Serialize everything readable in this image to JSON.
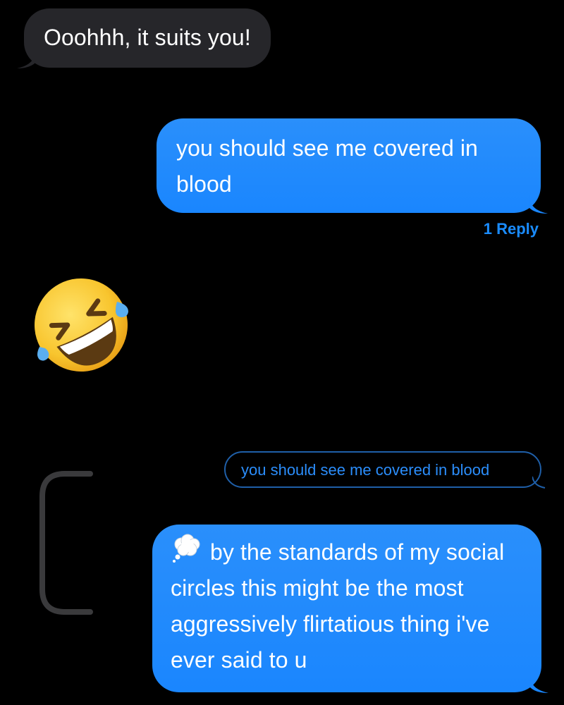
{
  "thread": {
    "messages": [
      {
        "direction": "received",
        "text": "Ooohhh, it suits you!"
      },
      {
        "direction": "sent",
        "text": "you should see me covered in blood"
      },
      {
        "direction": "sent",
        "text": "by the standards of my social circles this might be the most aggressively flirtatious thing i've ever said to u"
      }
    ],
    "reply_count": "1 Reply",
    "reaction_emoji": "rolling-on-floor-laughing-emoji",
    "quoted_message": "you should see me covered in blood"
  },
  "message_3_icon": "thought-balloon-icon",
  "colors": {
    "background": "#000000",
    "received_bubble": "#26262a",
    "sent_bubble": "#1a8cff",
    "accent": "#1a8cff",
    "quote_border": "#1f5fa8"
  }
}
